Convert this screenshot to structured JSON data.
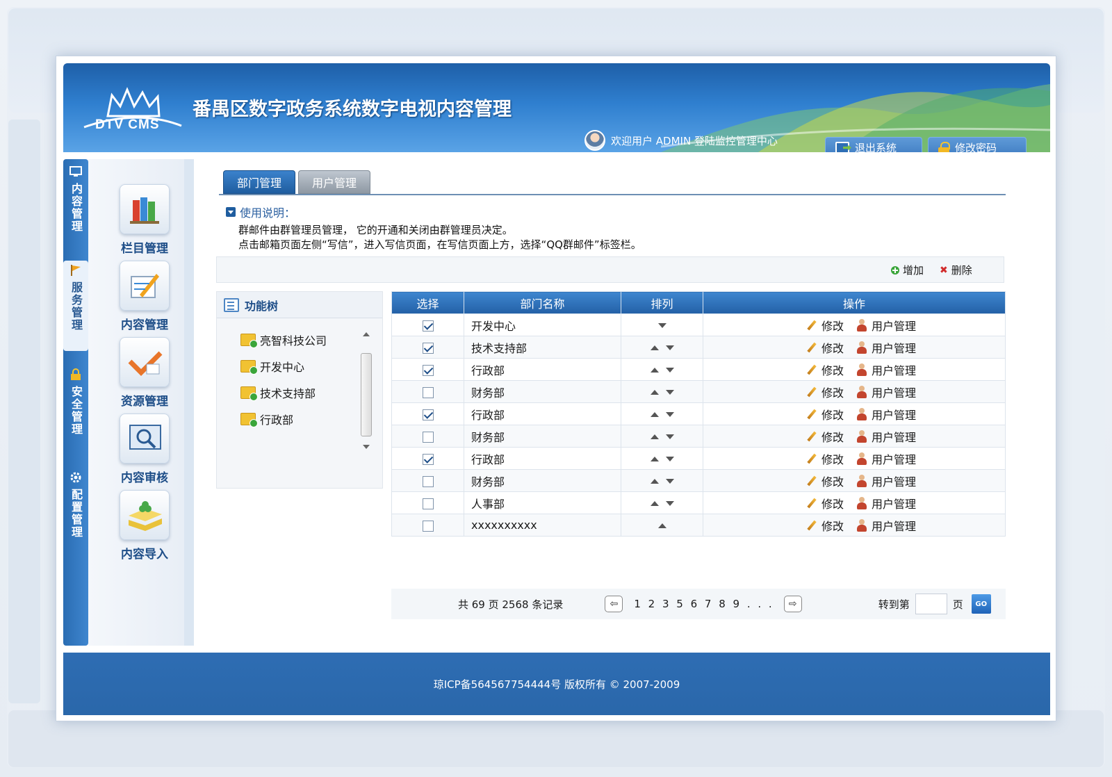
{
  "header": {
    "logo_text": "DTV CMS",
    "title": "番禺区数字政务系统数字电视内容管理",
    "welcome": "欢迎用户 ADMIN 登陆监控管理中心",
    "logout_label": "退出系统",
    "change_password_label": "修改密码"
  },
  "vnav": [
    {
      "label": "内容管理",
      "icon": "monitor-icon"
    },
    {
      "label": "服务管理",
      "icon": "flag-icon"
    },
    {
      "label": "安全管理",
      "icon": "lock-icon"
    },
    {
      "label": "配置管理",
      "icon": "gear-icon"
    }
  ],
  "menu": [
    {
      "label": "栏目管理",
      "icon": "books-icon"
    },
    {
      "label": "内容管理",
      "icon": "edit-icon"
    },
    {
      "label": "资源管理",
      "icon": "check-icon"
    },
    {
      "label": "内容审核",
      "icon": "magnifier-icon"
    },
    {
      "label": "内容导入",
      "icon": "clover-icon"
    }
  ],
  "tabs": [
    {
      "label": "部门管理",
      "active": true
    },
    {
      "label": "用户管理",
      "active": false
    }
  ],
  "instructions": {
    "title": "使用说明：",
    "line1": "群邮件由群管理员管理， 它的开通和关闭由群管理员决定。",
    "line2": "点击邮箱页面左侧“写信”，进入写信页面，在写信页面上方，选择“QQ群邮件”标签栏。"
  },
  "actions": {
    "add": "增加",
    "delete": "删除"
  },
  "tree": {
    "title": "功能树",
    "items": [
      "亮智科技公司",
      "开发中心",
      "技术支持部",
      "行政部"
    ]
  },
  "table": {
    "headers": [
      "选择",
      "部门名称",
      "排列",
      "操作"
    ],
    "edit_label": "修改",
    "user_label": "用户管理",
    "rows": [
      {
        "checked": true,
        "name": "开发中心",
        "up": false,
        "down": true
      },
      {
        "checked": true,
        "name": "技术支持部",
        "up": true,
        "down": true
      },
      {
        "checked": true,
        "name": "行政部",
        "up": true,
        "down": true
      },
      {
        "checked": false,
        "name": "财务部",
        "up": true,
        "down": true
      },
      {
        "checked": true,
        "name": "行政部",
        "up": true,
        "down": true
      },
      {
        "checked": false,
        "name": "财务部",
        "up": true,
        "down": true
      },
      {
        "checked": true,
        "name": "行政部",
        "up": true,
        "down": true
      },
      {
        "checked": false,
        "name": "财务部",
        "up": true,
        "down": true
      },
      {
        "checked": false,
        "name": "人事部",
        "up": true,
        "down": true
      },
      {
        "checked": false,
        "name": "xxxxxxxxxx",
        "up": true,
        "down": false
      }
    ]
  },
  "pager": {
    "info": "共 69 页 2568 条记录",
    "pages": "1 2 3 5 6 7 8 9 . . .",
    "goto_label": "转到第",
    "page_unit": "页",
    "go_label": "GO"
  },
  "footer": {
    "text": "琼ICP备564567754444号  版权所有  © 2007-2009"
  },
  "colors": {
    "primary": "#2a6db3",
    "header_dark": "#1e5fa8",
    "table_head": "#2360a6"
  }
}
